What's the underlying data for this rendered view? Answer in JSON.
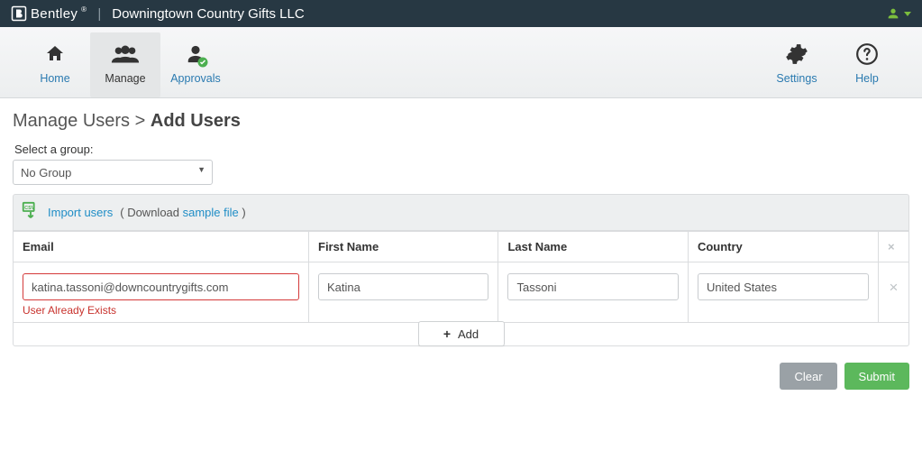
{
  "topbar": {
    "brand": "Bentley",
    "company": "Downingtown Country Gifts LLC"
  },
  "nav": {
    "left": [
      {
        "id": "home",
        "label": "Home"
      },
      {
        "id": "manage",
        "label": "Manage"
      },
      {
        "id": "approvals",
        "label": "Approvals"
      }
    ],
    "right": [
      {
        "id": "settings",
        "label": "Settings"
      },
      {
        "id": "help",
        "label": "Help"
      }
    ],
    "active": "manage"
  },
  "breadcrumb": {
    "parent": "Manage Users",
    "sep": ">",
    "current": "Add Users"
  },
  "group": {
    "label": "Select a group:",
    "value": "No Group"
  },
  "importBar": {
    "importLink": "Import users",
    "downloadPrefix": "( Download ",
    "sampleLink": "sample file",
    "downloadSuffix": " )"
  },
  "table": {
    "headers": {
      "email": "Email",
      "first": "First Name",
      "last": "Last Name",
      "country": "Country"
    },
    "rows": [
      {
        "email": "katina.tassoni@downcountrygifts.com",
        "emailError": "User Already Exists",
        "first": "Katina",
        "last": "Tassoni",
        "country": "United States"
      }
    ]
  },
  "addLabel": "Add",
  "buttons": {
    "clear": "Clear",
    "submit": "Submit"
  }
}
